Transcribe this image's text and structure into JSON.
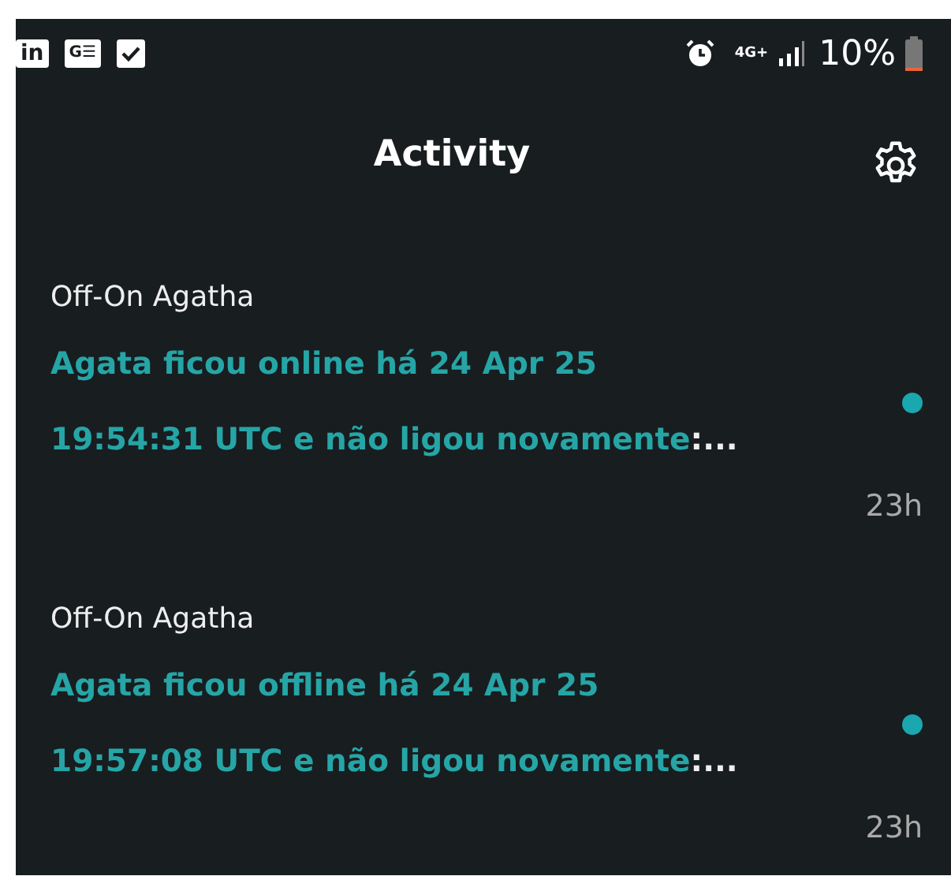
{
  "status_bar": {
    "left_icons": [
      {
        "kind": "badge",
        "label": "in"
      },
      {
        "kind": "badge",
        "label": "G☰"
      },
      {
        "kind": "check"
      }
    ],
    "network": "4G+",
    "battery": "10%",
    "level": 0.1
  },
  "header": {
    "title": "Activity"
  },
  "items": [
    {
      "source": "Off-On Agatha",
      "message": "Agata ficou online há 24 Apr 25\n19:54:31 UTC e não ligou novamente",
      "overflow": ":...",
      "unread": true,
      "time": "23h"
    },
    {
      "source": "Off-On Agatha",
      "message": "Agata ficou offline há 24 Apr 25\n19:57:08 UTC e não ligou novamente",
      "overflow": ":...",
      "unread": true,
      "time": "23h"
    }
  ]
}
